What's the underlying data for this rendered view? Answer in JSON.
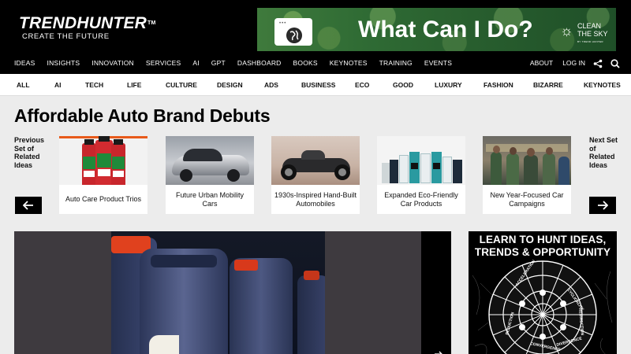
{
  "header": {
    "logo_main": "TRENDHUNTER",
    "logo_tm": "TM",
    "logo_sub": "CREATE THE FUTURE",
    "ad": {
      "headline": "What Can I Do?",
      "window_dots": "•••",
      "brand": "CLEAN THE SKY",
      "brand_sub": "BY TREND HUNTER"
    },
    "nav": [
      "IDEAS",
      "INSIGHTS",
      "INNOVATION",
      "SERVICES",
      "AI",
      "GPT",
      "DASHBOARD",
      "BOOKS",
      "KEYNOTES",
      "TRAINING",
      "EVENTS"
    ],
    "right_nav": {
      "about": "ABOUT",
      "login": "LOG IN"
    }
  },
  "categories": [
    "ALL",
    "AI",
    "TECH",
    "LIFE",
    "CULTURE",
    "DESIGN",
    "ADS",
    "BUSINESS",
    "ECO",
    "GOOD",
    "LUXURY",
    "FASHION",
    "BIZARRE",
    "KEYNOTES"
  ],
  "article": {
    "title": "Affordable Auto Brand Debuts"
  },
  "related": {
    "prev_label": "Previous Set of Related Ideas",
    "next_label": "Next Set of Related Ideas",
    "cards": [
      {
        "caption": "Auto Care Product Trios"
      },
      {
        "caption": "Future Urban Mobility Cars"
      },
      {
        "caption": "1930s-Inspired Hand-Built Automobiles"
      },
      {
        "caption": "Expanded Eco-Friendly Car Products"
      },
      {
        "caption": "New Year-Focused Car Campaigns"
      }
    ]
  },
  "promo": {
    "line1": "LEARN TO HUNT IDEAS,",
    "line2": "TRENDS & OPPORTUNITY",
    "wheel_labels": [
      "CYCLICALITY",
      "ACCELERATION",
      "REDIRECTION",
      "CONVERGENCE",
      "DIVERGENCE",
      "REDUCTION"
    ]
  },
  "colors": {
    "header_bg": "#000000",
    "page_bg": "#ececec",
    "card_bg": "#ffffff"
  }
}
